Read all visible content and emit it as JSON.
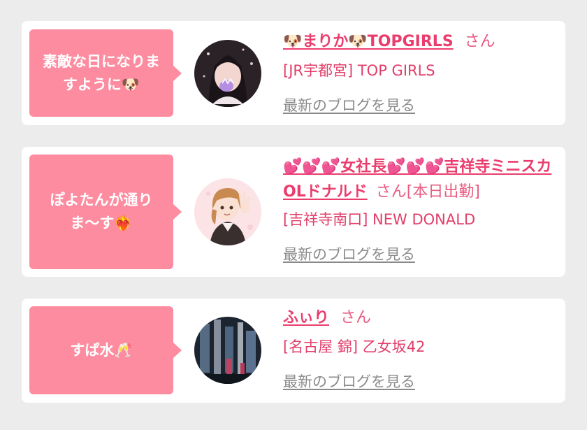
{
  "colors": {
    "page_bg": "#ececec",
    "card_bg": "#ffffff",
    "bubble_bg": "#fe8ca0",
    "name_link": "#ea3d6d",
    "shop_text": "#e23e6a",
    "blog_link": "#8a8a8a"
  },
  "entries": [
    {
      "message": "素敵な日になりま\nすように🐶",
      "name": "🐶まりか🐶TOPGIRLS",
      "honorific": "さん",
      "status": "",
      "shop": "[JR宇都宮] TOP GIRLS",
      "blog_link": "最新のブログを見る",
      "avatar_icon": "girl-photo-avatar"
    },
    {
      "message": "ぽよたんが通り\nま〜す❤️‍🔥",
      "name": "💕💕💕女社長💕💕💕吉祥寺ミニスカOLドナルド",
      "honorific": "さん",
      "status": "[本日出勤]",
      "shop": "[吉祥寺南口] NEW DONALD",
      "blog_link": "最新のブログを見る",
      "avatar_icon": "anime-girl-avatar"
    },
    {
      "message": "すぱ水🥂",
      "name": "ふぃり",
      "honorific": "さん",
      "status": "",
      "shop": "[名古屋 錦] 乙女坂42",
      "blog_link": "最新のブログを見る",
      "avatar_icon": "night-scene-avatar"
    }
  ]
}
